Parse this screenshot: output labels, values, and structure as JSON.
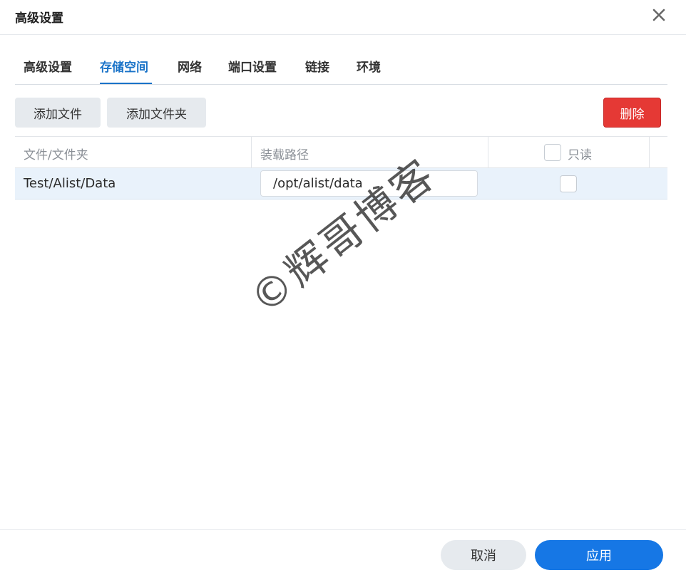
{
  "dialog": {
    "title": "高级设置",
    "close_icon": "close-icon"
  },
  "tabs": [
    {
      "label": "高级设置"
    },
    {
      "label": "存储空间",
      "active": true
    },
    {
      "label": "网络"
    },
    {
      "label": "端口设置"
    },
    {
      "label": "链接"
    },
    {
      "label": "环境"
    }
  ],
  "toolbar": {
    "add_file_label": "添加文件",
    "add_folder_label": "添加文件夹",
    "delete_label": "删除"
  },
  "table": {
    "headers": [
      "文件/文件夹",
      "装载路径",
      "只读"
    ],
    "rows": [
      {
        "folder": "Test/Alist/Data",
        "mount_path": "/opt/alist/data",
        "readonly": false
      }
    ]
  },
  "watermark": "©辉哥博客",
  "footer": {
    "cancel_label": "取消",
    "apply_label": "应用"
  },
  "colors": {
    "accent": "#1677e5",
    "danger": "#e53935",
    "selected_row": "#e9f2fb"
  }
}
